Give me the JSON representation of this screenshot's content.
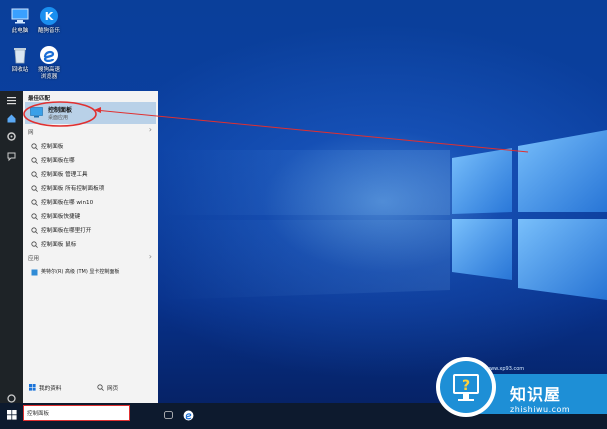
{
  "desktop": {
    "icons": [
      {
        "label": "此电脑",
        "icon": "computer-icon"
      },
      {
        "label": "酷狗音乐",
        "icon": "kugou-music-icon"
      },
      {
        "label": "回收站",
        "icon": "recycle-bin-icon"
      },
      {
        "label": "搜狗高速\n浏览器",
        "icon": "sogou-browser-icon"
      }
    ]
  },
  "start_menu": {
    "best_match_header": "最佳匹配",
    "best_match": {
      "title": "控制面板",
      "subtitle": "桌面应用"
    },
    "web_row": "网",
    "search_suggestions": [
      "控制面板",
      "控制面板在哪",
      "控制面板 管理工具",
      "控制面板 所有控制面板项",
      "控制面板在哪 win10",
      "控制面板快捷键",
      "控制面板在哪里打开",
      "控制面板 鼠标"
    ],
    "apps_header": "应用",
    "apps": [
      {
        "label": "英特尔(R) 高级 (TM) 显卡控制面板",
        "icon": "intel-graphics-icon"
      }
    ],
    "bottom_my_stuff": "我的资料",
    "bottom_web": "网页"
  },
  "taskbar": {
    "search_value": "控制面板"
  },
  "watermark": {
    "title": "知识屋",
    "url": "zhishiwu.com",
    "small_url": "www.xp93.com"
  },
  "colors": {
    "highlight": "#b9d1e8",
    "annotation_red": "#e03030",
    "start_bg": "#f3f3f3",
    "sidebar_bg": "#1e2327",
    "watermark_blue": "#1e8fd6"
  }
}
